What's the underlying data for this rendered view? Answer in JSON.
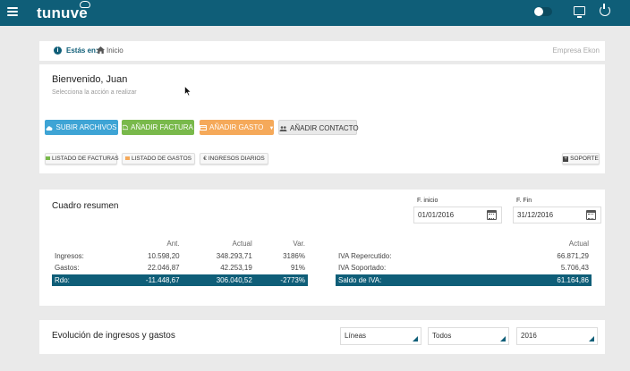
{
  "app": {
    "logo": "tunuve"
  },
  "breadcrumb": {
    "label": "Estás en:",
    "home": "Inicio",
    "company": "Empresa Ekon"
  },
  "welcome": {
    "title": "Bienvenido, Juan",
    "subtitle": "Selecciona la acción a realizar",
    "actions": {
      "upload": "SUBIR ARCHIVOS",
      "add_invoice": "AÑADIR FACTURA",
      "add_expense": "AÑADIR GASTO",
      "add_contact": "AÑADIR CONTACTO"
    },
    "links": {
      "invoices": "LISTADO DE FACTURAS",
      "expenses": "LISTADO DE GASTOS",
      "daily_income": "INGRESOS DIARIOS",
      "support": "SOPORTE"
    }
  },
  "summary": {
    "title": "Cuadro resumen",
    "start_label": "F. inicio",
    "start_value": "01/01/2016",
    "end_label": "F. Fin",
    "end_value": "31/12/2016",
    "left_headers": [
      "",
      "Ant.",
      "Actual",
      "Var."
    ],
    "left_rows": [
      [
        "Ingresos:",
        "10.598,20",
        "348.293,71",
        "3186%"
      ],
      [
        "Gastos:",
        "22.046,87",
        "42.253,19",
        "91%"
      ],
      [
        "Rdo:",
        "-11.448,67",
        "306.040,52",
        "-2773%"
      ]
    ],
    "right_header": "Actual",
    "right_rows": [
      [
        "IVA Repercutido:",
        "66.871,29"
      ],
      [
        "IVA Soportado:",
        "5.706,43"
      ],
      [
        "Saldo de IVA:",
        "61.164,86"
      ]
    ]
  },
  "evolution": {
    "title": "Evolución de ingresos y gastos",
    "chart_type": "Líneas",
    "filter": "Todos",
    "year": "2016"
  },
  "colors": {
    "brand": "#0f5e78",
    "blue": "#3ea4d5",
    "green": "#79b94b",
    "orange": "#f5a95a"
  }
}
